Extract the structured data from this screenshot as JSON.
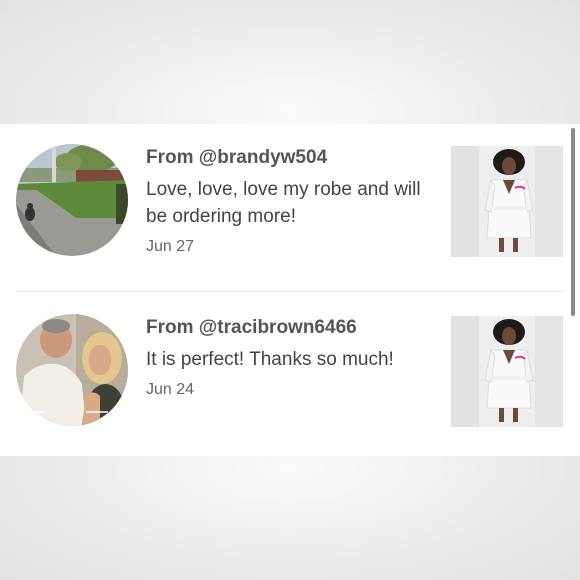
{
  "reviews": [
    {
      "from": "From @brandyw504",
      "message": "Love, love, love my robe and will be ordering more!",
      "date": "Jun 27",
      "avatar_icon": "yard-photo-avatar",
      "thumbnail_icon": "white-robe-product-photo"
    },
    {
      "from": "From @tracibrown6466",
      "message": "It is perfect! Thanks so much!",
      "date": "Jun 24",
      "avatar_icon": "couple-photo-avatar",
      "avatar_script": "love",
      "thumbnail_icon": "white-robe-product-photo"
    }
  ],
  "colors": {
    "card": "#ffffff",
    "backdrop": "#ececec",
    "text_primary": "#555555",
    "robe_accent": "#e0309a"
  }
}
